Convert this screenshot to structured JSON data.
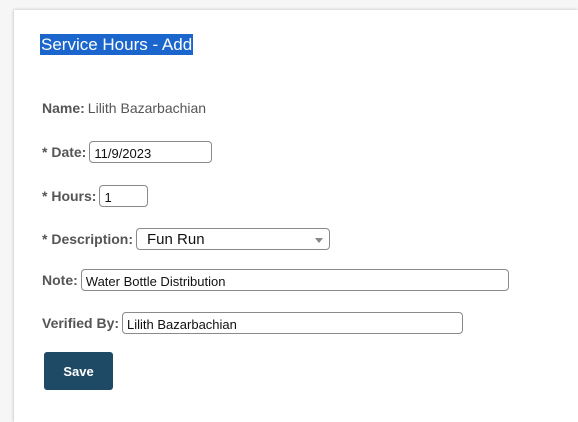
{
  "form": {
    "title": "Service Hours - Add",
    "name_label": "Name:",
    "name_value": "Lilith Bazarbachian",
    "date_label": "* Date:",
    "date_value": "11/9/2023",
    "hours_label": "* Hours:",
    "hours_value": "1",
    "description_label": "* Description:",
    "description_value": "Fun Run",
    "note_label": "Note:",
    "note_value": "Water Bottle Distribution",
    "verified_label": "Verified By:",
    "verified_value": "Lilith Bazarbachian",
    "save_label": "Save"
  },
  "colors": {
    "title_highlight": "#1a66cc",
    "save_button": "#1e4a66"
  }
}
